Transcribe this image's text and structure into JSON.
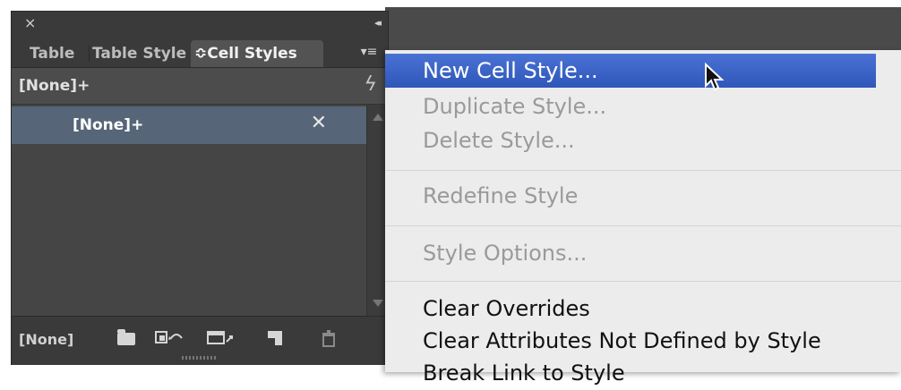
{
  "panel": {
    "tabs": [
      {
        "label": "Table"
      },
      {
        "label": "Table Style"
      },
      {
        "label": "≎Cell Styles"
      }
    ],
    "default_style_label": "[None]+",
    "styles": [
      {
        "label": "[None]+"
      }
    ],
    "bottom_style_label": "[None]",
    "icons": {
      "close": "×",
      "collapse": "◂◂",
      "panel_menu": "▾≡",
      "lightning": "ϟ",
      "clear_overrides": "✕"
    }
  },
  "menu": {
    "items": [
      {
        "label": "New Cell Style...",
        "state": "highlight"
      },
      {
        "label": "Duplicate Style...",
        "state": "disabled"
      },
      {
        "label": "Delete Style...",
        "state": "disabled"
      },
      {
        "label": "Redefine Style",
        "state": "disabled"
      },
      {
        "label": "Style Options...",
        "state": "disabled"
      },
      {
        "label": "Clear Overrides",
        "state": "enabled"
      },
      {
        "label": "Clear Attributes Not Defined by Style",
        "state": "enabled"
      },
      {
        "label": "Break Link to Style",
        "state": "enabled"
      }
    ]
  },
  "colors": {
    "panel_bg": "#454545",
    "selected_row": "#566577",
    "menu_highlight": "#3b64c6",
    "menu_bg": "#ececec"
  }
}
